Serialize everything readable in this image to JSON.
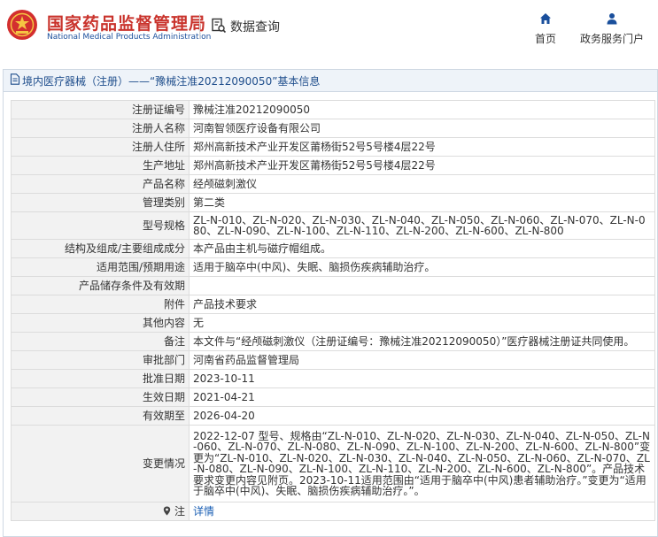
{
  "header": {
    "brand_cn": "国家药品监督管理局",
    "brand_en": "National Medical Products Administration",
    "query_label": "数据查询",
    "nav": {
      "home": "首页",
      "service": "政务服务门户"
    }
  },
  "colors": {
    "brand_red": "#c9332c",
    "brand_blue": "#1a4f9c",
    "title_blue": "#1f4e8c",
    "link_blue": "#1a5fb4"
  },
  "card": {
    "title": "境内医疗器械（注册）——“豫械注准20212090050”基本信息"
  },
  "rows": [
    {
      "label": "注册证编号",
      "value": "豫械注准20212090050"
    },
    {
      "label": "注册人名称",
      "value": "河南智领医疗设备有限公司"
    },
    {
      "label": "注册人住所",
      "value": "郑州高新技术产业开发区莆杨街52号5号楼4层22号"
    },
    {
      "label": "生产地址",
      "value": "郑州高新技术产业开发区莆杨街52号5号楼4层22号"
    },
    {
      "label": "产品名称",
      "value": "经颅磁刺激仪"
    },
    {
      "label": "管理类别",
      "value": "第二类"
    },
    {
      "label": "型号规格",
      "value": "ZL-N-010、ZL-N-020、ZL-N-030、ZL-N-040、ZL-N-050、ZL-N-060、ZL-N-070、ZL-N-080、ZL-N-090、ZL-N-100、ZL-N-110、ZL-N-200、ZL-N-600、ZL-N-800"
    },
    {
      "label": "结构及组成/主要组成成分",
      "value": "本产品由主机与磁疗帽组成。"
    },
    {
      "label": "适用范围/预期用途",
      "value": "适用于脑卒中(中风)、失眠、脑损伤疾病辅助治疗。"
    },
    {
      "label": "产品储存条件及有效期",
      "value": ""
    },
    {
      "label": "附件",
      "value": "产品技术要求"
    },
    {
      "label": "其他内容",
      "value": "无"
    },
    {
      "label": "备注",
      "value": "本文件与“经颅磁刺激仪（注册证编号：豫械注准20212090050）”医疗器械注册证共同使用。"
    },
    {
      "label": "审批部门",
      "value": "河南省药品监督管理局"
    },
    {
      "label": "批准日期",
      "value": "2023-10-11"
    },
    {
      "label": "生效日期",
      "value": "2021-04-21"
    },
    {
      "label": "有效期至",
      "value": "2026-04-20"
    },
    {
      "label": "变更情况",
      "value": "2022-12-07 型号、规格由“ZL-N-010、ZL-N-020、ZL-N-030、ZL-N-040、ZL-N-050、ZL-N-060、ZL-N-070、ZL-N-080、ZL-N-090、ZL-N-100、ZL-N-200、ZL-N-600、ZL-N-800”变更为“ZL-N-010、ZL-N-020、ZL-N-030、ZL-N-040、ZL-N-050、ZL-N-060、ZL-N-070、ZL-N-080、ZL-N-090、ZL-N-100、ZL-N-110、ZL-N-200、ZL-N-600、ZL-N-800”。产品技术要求变更内容见附页。2023-10-11适用范围由“适用于脑卒中(中风)患者辅助治疗。”变更为“适用于脑卒中(中风)、失眠、脑损伤疾病辅助治疗。”。"
    },
    {
      "label": "注",
      "value": "详情",
      "icon": "location-pin-icon"
    }
  ]
}
